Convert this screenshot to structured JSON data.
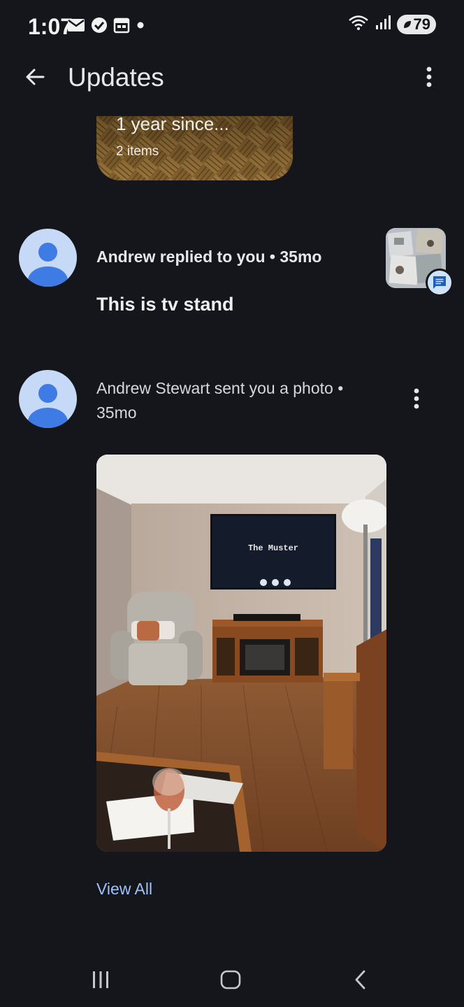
{
  "status_bar": {
    "time": "1:07",
    "battery": "79",
    "left_icons": [
      "mail-icon",
      "check-circle-icon",
      "calendar-icon",
      "dot-icon"
    ],
    "right_icons": [
      "wifi-icon",
      "signal-icon",
      "battery-icon"
    ]
  },
  "app_bar": {
    "title": "Updates"
  },
  "memory_card": {
    "title": "1 year since...",
    "count": "2 items"
  },
  "notifications": [
    {
      "header": "Andrew replied to you • 35mo",
      "message": "This is tv stand"
    },
    {
      "header_line1": "Andrew Stewart sent you a photo •",
      "header_line2": "35mo",
      "tv_text": "The Muster"
    }
  ],
  "view_all_label": "View All",
  "colors": {
    "background": "#14161c",
    "avatar_bg": "#c6d9f7",
    "avatar_fg": "#3e7be4",
    "link": "#9fc2f6"
  }
}
